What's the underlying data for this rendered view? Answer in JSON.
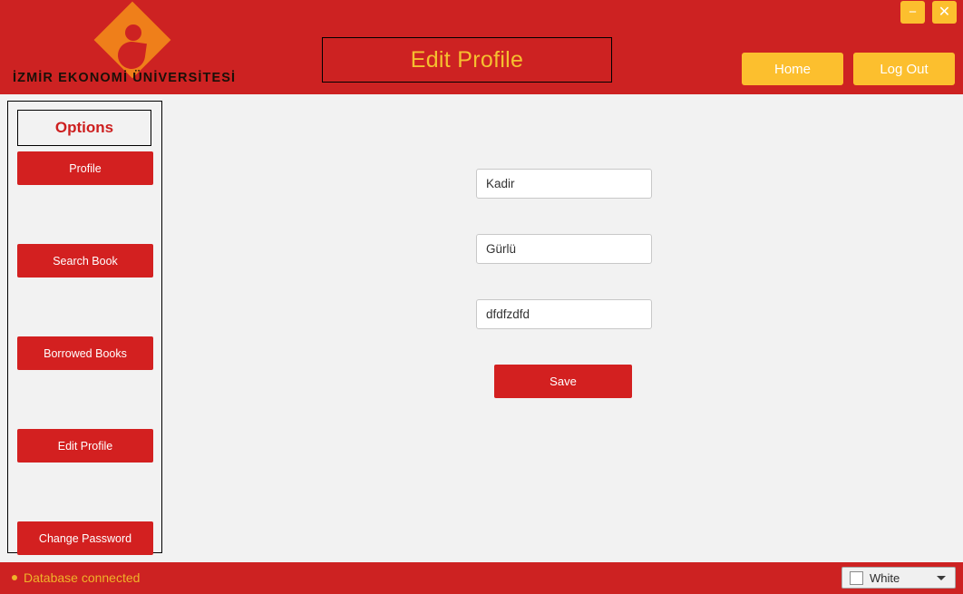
{
  "header": {
    "logo": {
      "icon": "izmir-ekonomi-logo",
      "text": "İZMİR EKONOMİ ÜNİVERSİTESİ"
    },
    "page_title": "Edit Profile",
    "nav": {
      "home_label": "Home",
      "logout_label": "Log Out"
    },
    "window_controls": {
      "minimize_label": "−",
      "close_label": "✕"
    },
    "colors": {
      "background": "#cd2222",
      "title_text": "#f5c02f",
      "button_background": "#fcbf2e"
    }
  },
  "sidebar": {
    "title": "Options",
    "items": [
      {
        "label": "Profile"
      },
      {
        "label": "Search Book"
      },
      {
        "label": "Borrowed Books"
      },
      {
        "label": "Edit Profile"
      },
      {
        "label": "Change Password"
      }
    ],
    "colors": {
      "title_text": "#cd1f1f",
      "button_background": "#d32020"
    }
  },
  "main": {
    "fields": [
      {
        "value": "Kadir",
        "placeholder": ""
      },
      {
        "value": "Gürlü",
        "placeholder": ""
      },
      {
        "value": "dfdfzdfd",
        "placeholder": ""
      }
    ],
    "save_label": "Save"
  },
  "statusbar": {
    "database_status": "Database connected",
    "status_color": "#f0b329",
    "theme_select": {
      "value": "White",
      "swatch_color": "#ffffff",
      "arrow_icon": "chevron-down-icon"
    }
  }
}
